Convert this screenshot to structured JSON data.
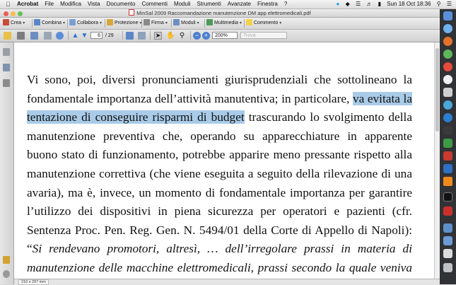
{
  "menubar": {
    "apple": "",
    "items": [
      "Acrobat",
      "File",
      "Modifica",
      "Vista",
      "Documento",
      "Commenti",
      "Moduli",
      "Strumenti",
      "Avanzate",
      "Finestra",
      "?"
    ],
    "clock": "Sun 18 Oct  18:36"
  },
  "window": {
    "title": "MinSal 2009 Raccomandazione manutenzione DM app elettromedicali.pdf"
  },
  "toolbar1": {
    "crea": "Crea",
    "combina": "Combina",
    "collabora": "Collabora",
    "protezione": "Protezione",
    "firma": "Firma",
    "moduli": "Moduli",
    "multimedia": "Multimedia",
    "commento": "Commento"
  },
  "toolbar2": {
    "page_current": "6",
    "page_total": "/ 29",
    "zoom": "200%",
    "font_field": "Trova"
  },
  "document": {
    "seg1": "Vi sono, poi, diversi pronunciamenti giurisprudenziali che sottolineano la fondamentale importanza dell’attività manutentiva; in particolare, ",
    "highlight": "va evitata la tentazione di conseguire risparmi di budget",
    "seg2": " trascurando lo svolgimento della manutenzione preventiva che, operando su apparecchiature in apparente buono stato di funzionamento, potrebbe apparire meno pressante rispetto alla manutenzione correttiva (che viene eseguita a seguito della rilevazione di una avaria), ma è, invece, un momento di fondamentale importanza per garantire l’utilizzo dei dispositivi in piena sicurezza per operatori e pazienti (cfr. Sentenza Proc. Pen. Reg. Gen. N. 5494/01 della Corte di Appello di Napoli): “",
    "italic": "Si rendevano promotori, altresì, … dell’irregolare prassi in materia di manutenzione delle macchine elettromedicali, prassi secondo la quale veniva conferita piena"
  },
  "statusbar": {
    "page_size": "210 x 297 mm"
  },
  "colors": {
    "highlight": "#a9cbe8",
    "dock": "#303236"
  }
}
